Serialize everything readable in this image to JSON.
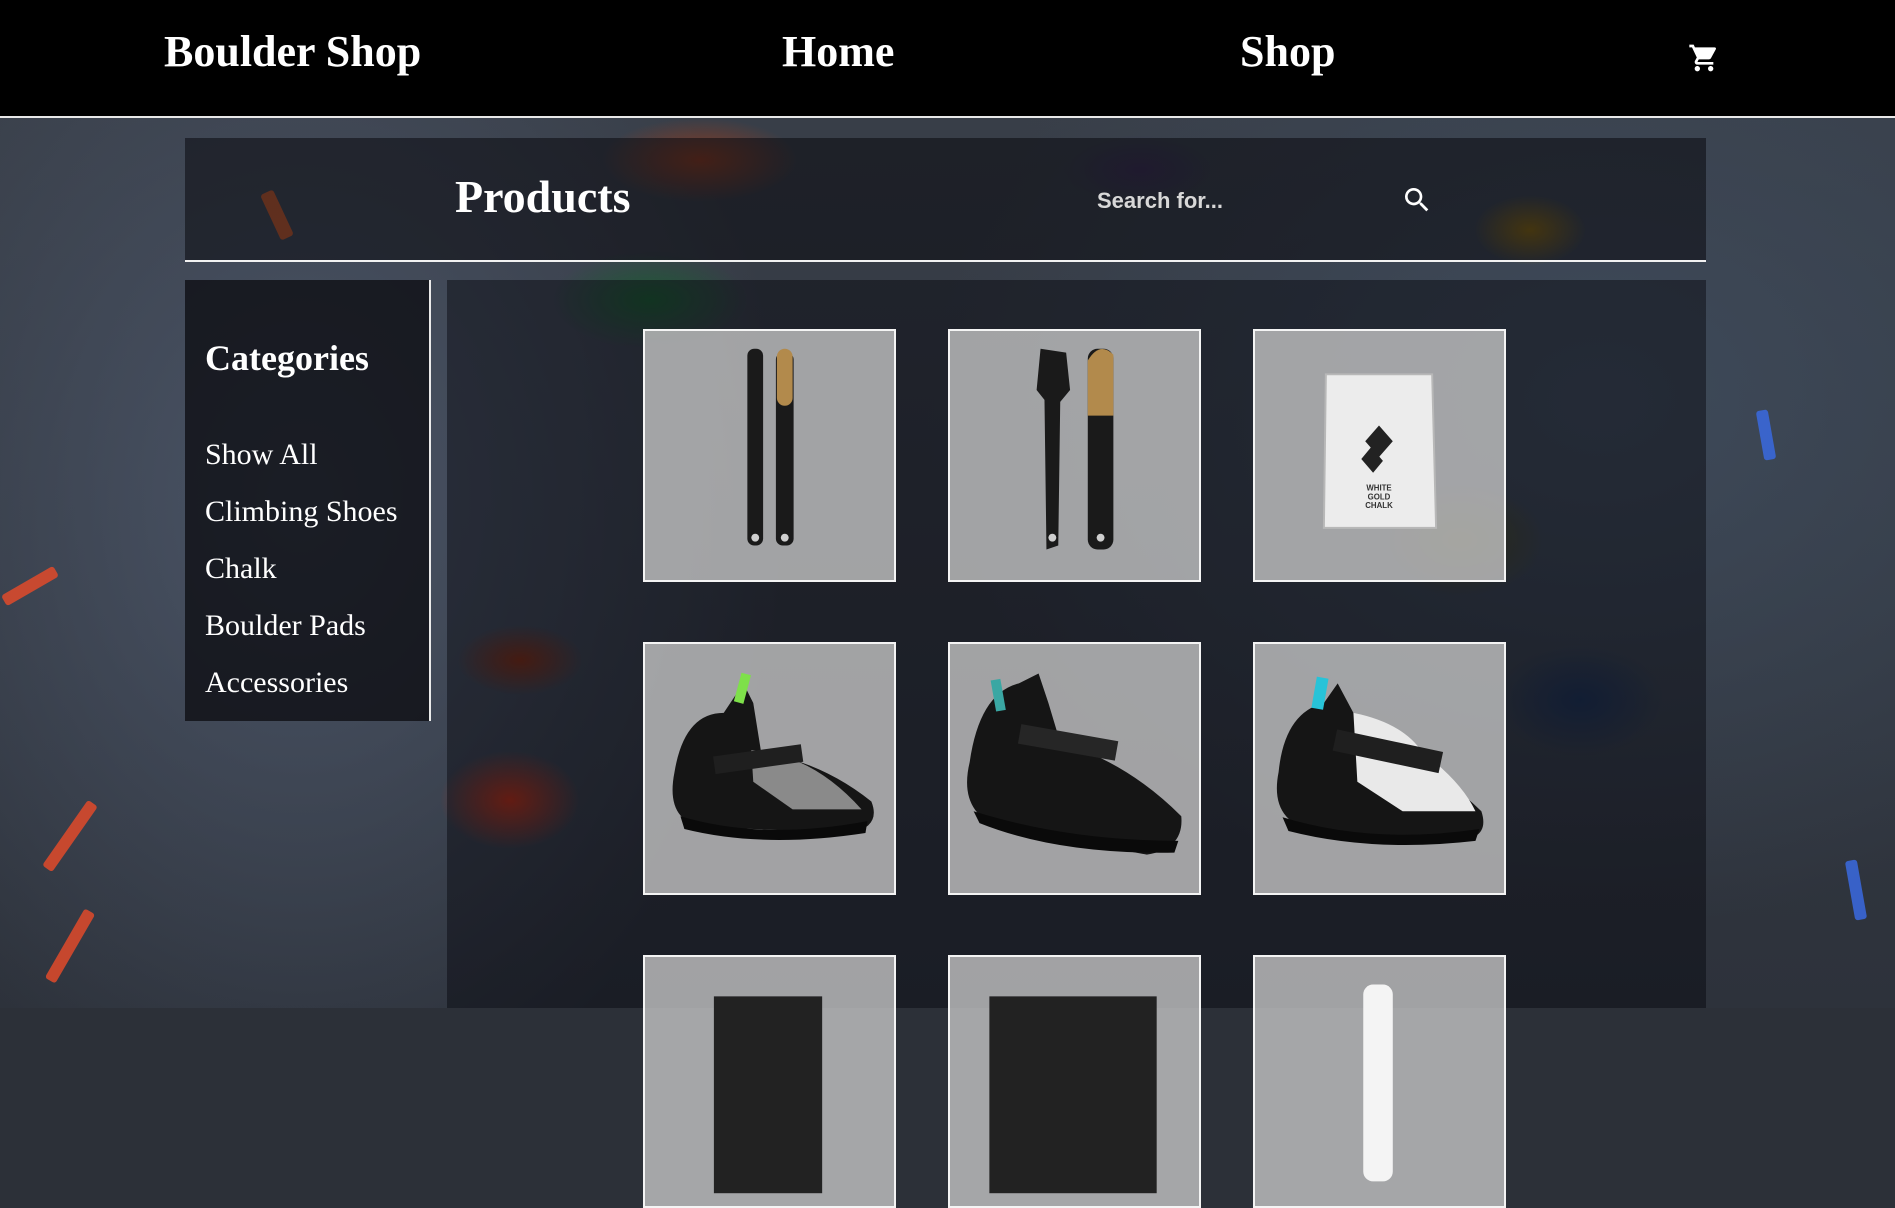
{
  "header": {
    "brand": "Boulder Shop",
    "nav": [
      {
        "label": "Home"
      },
      {
        "label": "Shop"
      }
    ],
    "cart_icon": "shopping-cart-icon"
  },
  "products": {
    "title": "Products",
    "search_placeholder": "Search for...",
    "search_icon": "search-icon"
  },
  "sidebar": {
    "title": "Categories",
    "items": [
      {
        "label": "Show All"
      },
      {
        "label": "Climbing Shoes"
      },
      {
        "label": "Chalk"
      },
      {
        "label": "Boulder Pads"
      },
      {
        "label": "Accessories"
      }
    ]
  },
  "grid": {
    "products": [
      {
        "icon": "brush-set-small-image"
      },
      {
        "icon": "brush-set-large-image"
      },
      {
        "icon": "chalk-bag-image",
        "label_lines": [
          "WHITE",
          "GOLD",
          "CHALK"
        ]
      },
      {
        "icon": "climbing-shoe-green-image"
      },
      {
        "icon": "climbing-shoe-black-image"
      },
      {
        "icon": "climbing-shoe-white-image"
      },
      {
        "icon": "product-image"
      },
      {
        "icon": "product-image"
      },
      {
        "icon": "product-image"
      }
    ]
  },
  "colors": {
    "header_bg": "#000000",
    "text": "#ffffff",
    "card_bg": "#c8c8c8",
    "accent_green": "#7ee04a",
    "accent_teal": "#3aa7a3",
    "accent_cyan": "#27c3d8"
  }
}
